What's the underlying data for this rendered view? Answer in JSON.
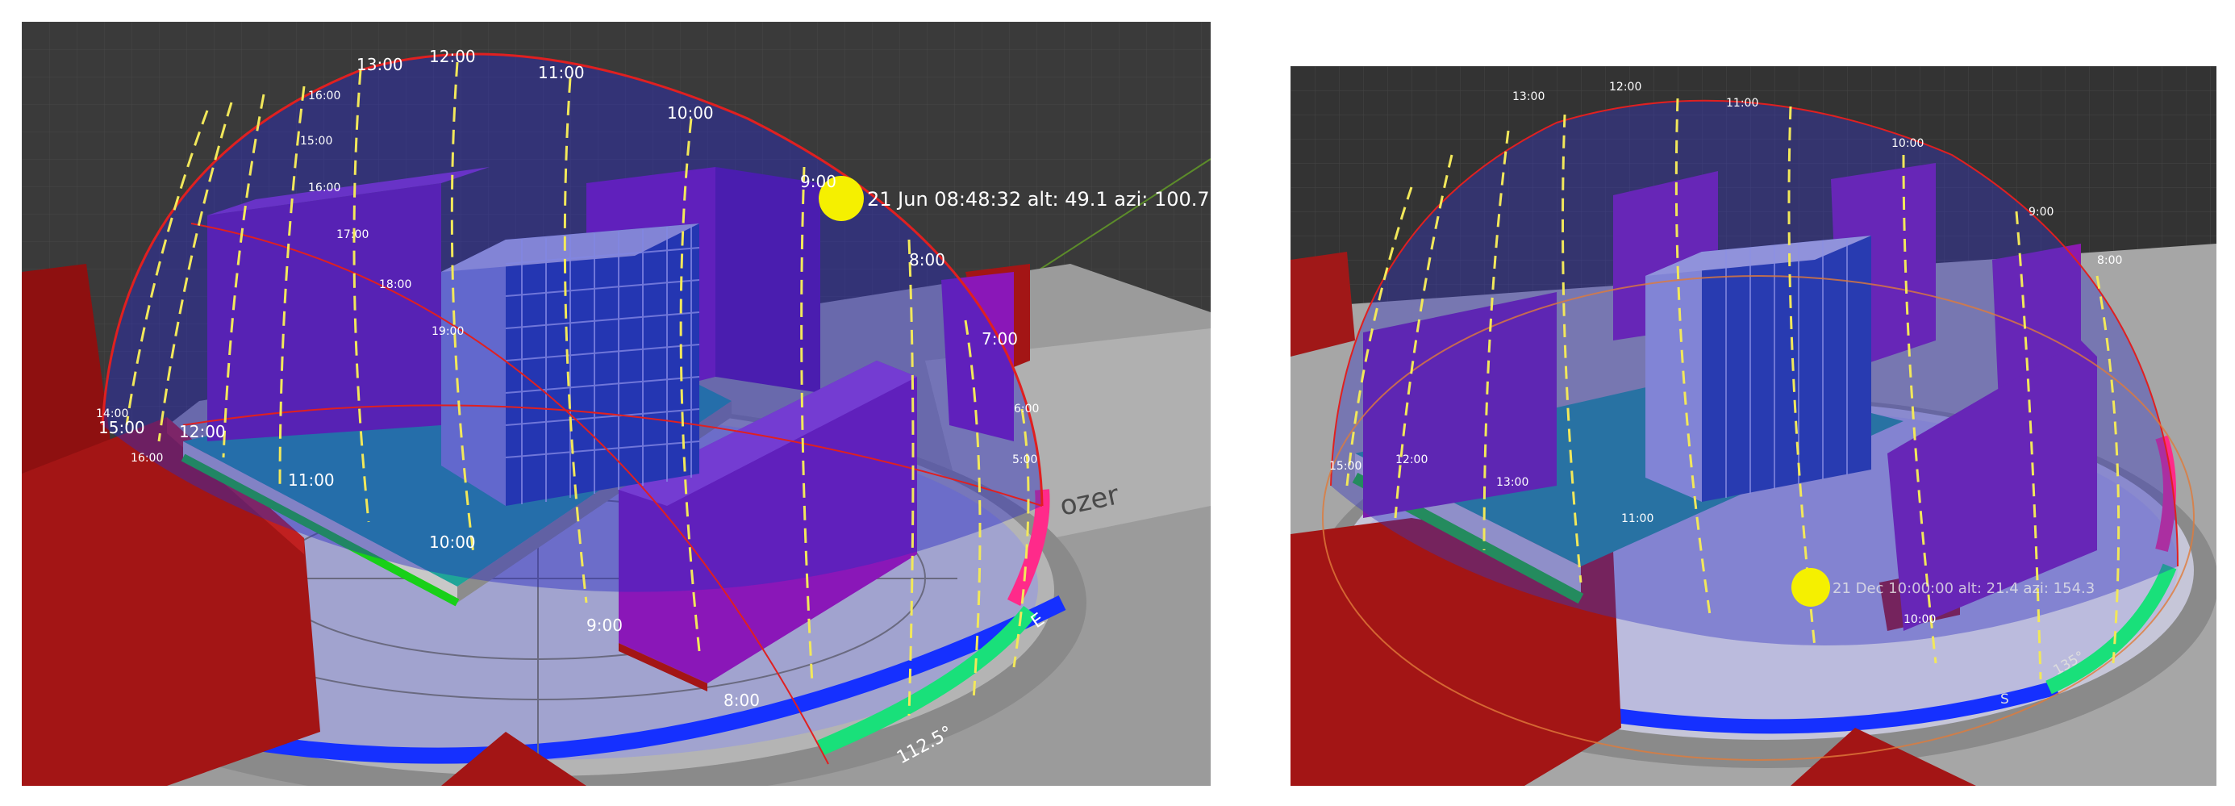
{
  "left_view": {
    "sun_info": "21 Jun 08:48:32 alt: 49.1 azi: 100.7",
    "arc_labels": [
      "13:00",
      "12:00",
      "11:00",
      "10:00",
      "9:00",
      "8:00",
      "7:00",
      "6:00",
      "5:00"
    ],
    "west_labels": [
      "16:00",
      "15:00",
      "16:00",
      "17:00",
      "18:00",
      "19:00"
    ],
    "ground_labels": [
      "14:00",
      "15:00",
      "16:00",
      "12:00",
      "11:00",
      "10:00",
      "9:00",
      "8:00"
    ],
    "compass": {
      "east": "E",
      "bearing": "112.5°",
      "side_text": "ozer"
    },
    "colors": {
      "sky_dome": "#3a3aa8",
      "building_main": "#8a17b8",
      "building_context": "#a01818",
      "sun": "#f5f000",
      "sun_path": "#f2e85a",
      "plaza": "#1fa598"
    }
  },
  "right_view": {
    "sun_info": "21 Dec 10:00:00 alt: 21.4 azi: 154.3",
    "arc_labels": [
      "13:00",
      "12:00",
      "11:00",
      "10:00",
      "9:00",
      "8:00"
    ],
    "ground_labels": [
      "15:00",
      "12:00",
      "13:00",
      "11:00",
      "10:00"
    ],
    "compass": {
      "bearing": "135°",
      "mark": "S"
    },
    "colors": {
      "sky_dome": "#6e6ec8",
      "building_main": "#8b1ab0",
      "building_context": "#a01818"
    }
  }
}
